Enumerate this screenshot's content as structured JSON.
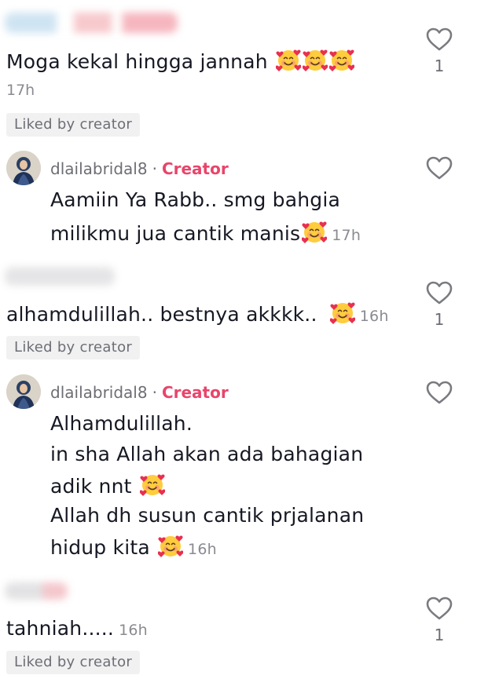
{
  "comments": [
    {
      "text": "Moga kekal hingga jannah",
      "emoji_count": 3,
      "time": "17h",
      "badge": "Liked by creator",
      "likes": "1"
    },
    {
      "username": "dlailabridal8",
      "separator": "·",
      "role": "Creator",
      "lines": [
        "Aamiin Ya Rabb.. smg bahgia",
        "milikmu jua cantik manis"
      ],
      "time": "17h"
    },
    {
      "text": "alhamdulillah.. bestnya akkkk..",
      "time": "16h",
      "badge": "Liked by creator",
      "likes": "1"
    },
    {
      "username": "dlailabridal8",
      "separator": "·",
      "role": "Creator",
      "lines": [
        "Alhamdulillah.",
        "in sha Allah akan ada bahagian",
        "adik nnt",
        "Allah dh susun cantik prjalanan",
        "hidup kita"
      ],
      "time": "16h"
    },
    {
      "text": "tahniah.....",
      "time": "16h",
      "badge": "Liked by creator",
      "likes": "1"
    }
  ],
  "icons": {
    "like": "heart-outline-icon",
    "emoji": "smiling-face-with-hearts-emoji"
  },
  "colors": {
    "creator": "#e8456b",
    "muted": "#8a8b91",
    "badge_bg": "#f1f1f2"
  }
}
